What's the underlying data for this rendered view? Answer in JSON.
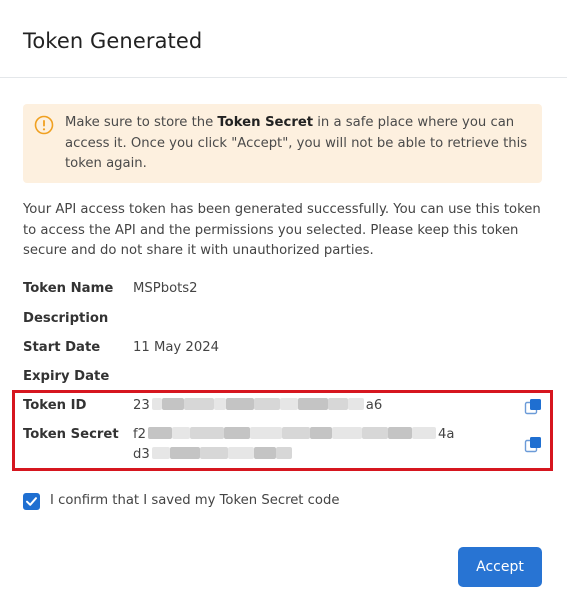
{
  "dialog": {
    "title": "Token Generated"
  },
  "alert": {
    "text_before": "Make sure to store the ",
    "bold": "Token Secret",
    "text_after": " in a safe place where you can access it. Once you click \"Accept\", you will not be able to retrieve this token again."
  },
  "description": "Your API access token has been generated successfully. You can use this token to access the API and the permissions you selected. Please keep this token secure and do not share it with unauthorized parties.",
  "fields": {
    "token_name": {
      "label": "Token Name",
      "value": "MSPbots2"
    },
    "description": {
      "label": "Description",
      "value": ""
    },
    "start_date": {
      "label": "Start Date",
      "value": "11 May 2024"
    },
    "expiry_date": {
      "label": "Expiry Date",
      "value": ""
    },
    "token_id": {
      "label": "Token ID",
      "prefix": "23",
      "suffix": "a6"
    },
    "token_secret": {
      "label": "Token Secret",
      "line1_prefix": "f2",
      "line1_suffix": "4a",
      "line2_prefix": "d3"
    }
  },
  "confirm": {
    "checked": true,
    "label": "I confirm that I saved my Token Secret code"
  },
  "actions": {
    "accept_label": "Accept"
  },
  "colors": {
    "primary": "#2874d3",
    "alert_bg": "#fdf0df",
    "alert_icon": "#f0a020",
    "highlight": "#d6161f"
  }
}
